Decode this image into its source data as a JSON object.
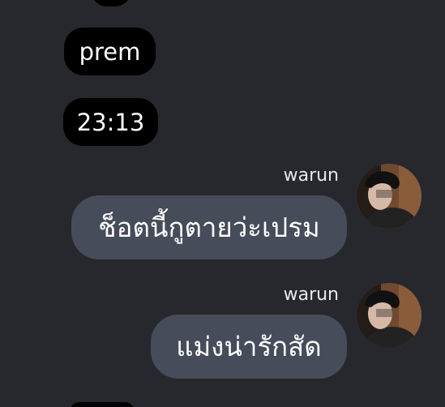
{
  "messages": [
    {
      "side": "left",
      "text": "prem"
    },
    {
      "side": "left",
      "text": "23:13"
    },
    {
      "side": "right",
      "sender": "warun",
      "text": "ช็อตนี้กูตายว่ะเปรม",
      "avatar_icon": "profile-photo"
    },
    {
      "side": "right",
      "sender": "warun",
      "text": "แม่งน่ารักสัด",
      "avatar_icon": "profile-photo"
    }
  ],
  "colors": {
    "background": "#27282d",
    "left_bubble": "#000000",
    "right_bubble": "#464c5a",
    "text": "#ffffff"
  }
}
